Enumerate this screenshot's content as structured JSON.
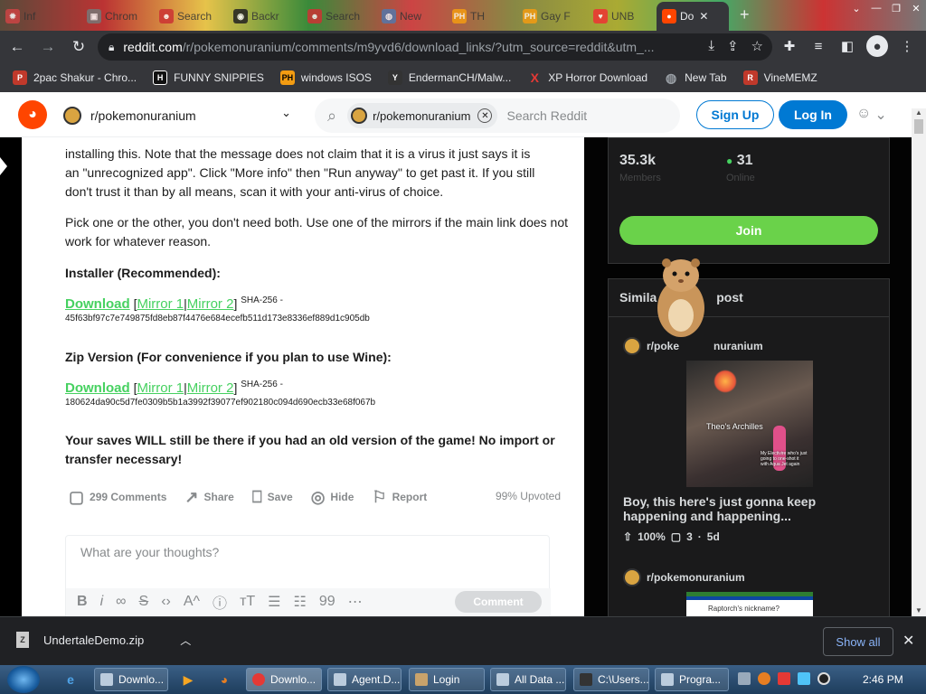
{
  "browser": {
    "tabs": [
      {
        "label": "Inf"
      },
      {
        "label": "Chrom"
      },
      {
        "label": "Search"
      },
      {
        "label": "Backr"
      },
      {
        "label": "Search"
      },
      {
        "label": "New"
      },
      {
        "label": "TH"
      },
      {
        "label": "Gay F"
      },
      {
        "label": "UNB"
      },
      {
        "label": "Do"
      }
    ],
    "new_tab_symbol": "+",
    "url_domain": "reddit.com",
    "url_path": "/r/pokemonuranium/comments/m9yvd6/download_links/?utm_source=reddit&utm_...",
    "bookmarks": [
      {
        "label": "2pac Shakur - Chro...",
        "color": "#c0392b",
        "icon": "P"
      },
      {
        "label": "FUNNY SNIPPIES",
        "color": "#111111",
        "icon": "H"
      },
      {
        "label": "windows ISOS",
        "color": "#f39c12",
        "icon": "PH"
      },
      {
        "label": "EndermanCH/Malw...",
        "color": "#333333",
        "icon": "Y"
      },
      {
        "label": "XP Horror Download",
        "color": "#c0392b",
        "icon": "X"
      },
      {
        "label": "New Tab",
        "color": "#5f6368",
        "icon": "◍"
      },
      {
        "label": "VineMEMZ",
        "color": "#c0392b",
        "icon": "R"
      }
    ]
  },
  "reddit": {
    "logo": "reddit-logo",
    "subreddit": "r/pokemonuranium",
    "search_chip": "r/pokemonuranium",
    "search_placeholder": "Search Reddit",
    "signup": "Sign Up",
    "login": "Log In"
  },
  "post": {
    "paragraph1_line1": "installing this. Note that the message does not claim that it is a virus it just says it is",
    "paragraph1_line2": "an \"unrecognized app\". Click \"More info\" then \"Run anyway\" to get past it. If you still",
    "paragraph1_line3": "don't trust it than by all means, scan it with your anti-virus of choice.",
    "paragraph2": "Pick one or the other, you don't need both. Use one of the mirrors if the main link does not work for whatever reason.",
    "installer_heading": "Installer (Recommended):",
    "installer": {
      "download": "Download",
      "mirror1": "Mirror 1",
      "mirror2": "Mirror 2",
      "sha_label": "SHA-256 -",
      "hash": "45f63bf97c7e749875fd8eb87f4476e684ecefb511d173e8336ef889d1c905db"
    },
    "zip_heading": "Zip Version (For convenience if you plan to use Wine):",
    "zip": {
      "download": "Download",
      "mirror1": "Mirror 1",
      "mirror2": "Mirror 2",
      "sha_label": "SHA-256 -",
      "hash": "180624da90c5d7fe0309b5b1a3992f39077ef902180c094d690ecb33e68f067b"
    },
    "saves_note": "Your saves WILL still be there if you had an old version of the game! No import or transfer necessary!",
    "actions": {
      "comments": "299 Comments",
      "share": "Share",
      "save": "Save",
      "hide": "Hide",
      "report": "Report",
      "upvoted": "99% Upvoted"
    },
    "comment_placeholder": "What are your thoughts?",
    "comment_button": "Comment"
  },
  "sidebar": {
    "members_count": "35.3k",
    "members_label": "Members",
    "online_count": "31",
    "online_label": "Online",
    "join": "Join",
    "similar_header_left": "Simila",
    "similar_header_right": "post",
    "sim1_sub": "r/pokemonuranium",
    "sim1_sub_visible": "r/poke",
    "sim1_sub_tail": "nuranium",
    "sim1_caption": "Theo's Archilles",
    "sim1_caption2": "My Electivire who's just going to one-shot it with Aqua Jet again",
    "sim1_title": "Boy, this here's just gonna keep happening and happening...",
    "sim1_percent": "100%",
    "sim1_comments": "3",
    "sim1_age": "5d",
    "sim2_sub": "r/pokemonuranium",
    "sim2_caption": "Raptorch's nickname?"
  },
  "downloads": {
    "file": "UndertaleDemo.zip",
    "show_all": "Show all"
  },
  "taskbar": {
    "buttons": [
      {
        "label": "Downlo..."
      },
      {
        "label": "Downlo..."
      },
      {
        "label": "Agent.D..."
      },
      {
        "label": "Login"
      },
      {
        "label": "All Data ..."
      },
      {
        "label": "C:\\Users..."
      },
      {
        "label": "Progra..."
      }
    ],
    "clock": "2:46 PM"
  },
  "colors": {
    "reddit_orange": "#ff4500",
    "reddit_blue": "#0079d3",
    "link_green": "#46d160",
    "join_green": "#6ad24a",
    "chrome_dark": "#35363a"
  }
}
